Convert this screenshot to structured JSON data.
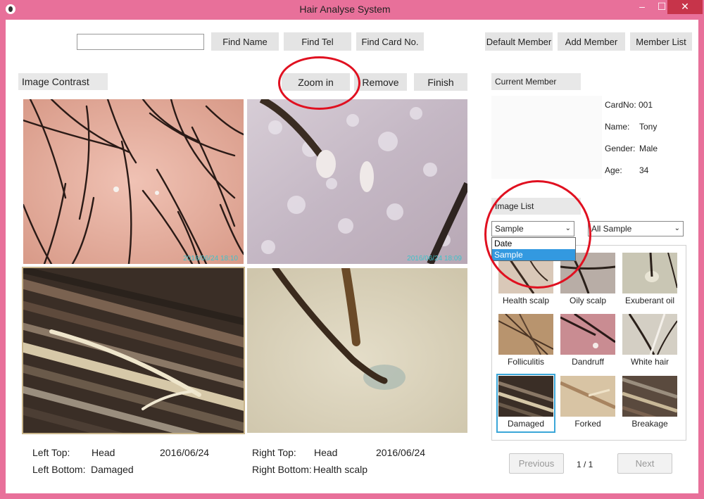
{
  "window": {
    "title": "Hair Analyse System",
    "minimize": "–",
    "maximize": "☐",
    "close": "✕"
  },
  "toolbar": {
    "search_value": "",
    "find_name": "Find Name",
    "find_tel": "Find Tel",
    "find_card": "Find Card No.",
    "default_member": "Default Member",
    "add_member": "Add Member",
    "member_list": "Member List"
  },
  "contrast": {
    "label": "Image Contrast",
    "zoom_in": "Zoom in",
    "remove": "Remove",
    "finish": "Finish",
    "images": [
      {
        "timestamp": "2016/06/24 18:10"
      },
      {
        "timestamp": "2016/06/24 18:09"
      },
      {
        "timestamp": ""
      },
      {
        "timestamp": ""
      }
    ]
  },
  "captions": {
    "left_top_label": "Left Top:",
    "left_top_part": "Head",
    "left_top_date": "2016/06/24",
    "left_bottom_label": "Left Bottom:",
    "left_bottom_value": "Damaged",
    "right_top_label": "Right Top:",
    "right_top_part": "Head",
    "right_top_date": "2016/06/24",
    "right_bottom_label": "Right Bottom:",
    "right_bottom_value": "Health scalp"
  },
  "member": {
    "label": "Current Member",
    "cardno_label": "CardNo:",
    "cardno": "001",
    "name_label": "Name:",
    "name": "Tony",
    "gender_label": "Gender:",
    "gender": "Male",
    "age_label": "Age:",
    "age": "34"
  },
  "image_list": {
    "label": "Image List",
    "sort_selected": "Sample",
    "sort_options": [
      "Date",
      "Sample"
    ],
    "filter_selected": "All Sample",
    "thumbnails": [
      "Health scalp",
      "Oily scalp",
      "Exuberant oil",
      "Folliculitis",
      "Dandruff",
      "White hair",
      "Damaged",
      "Forked",
      "Breakage"
    ]
  },
  "pager": {
    "previous": "Previous",
    "page": "1 / 1",
    "next": "Next"
  }
}
